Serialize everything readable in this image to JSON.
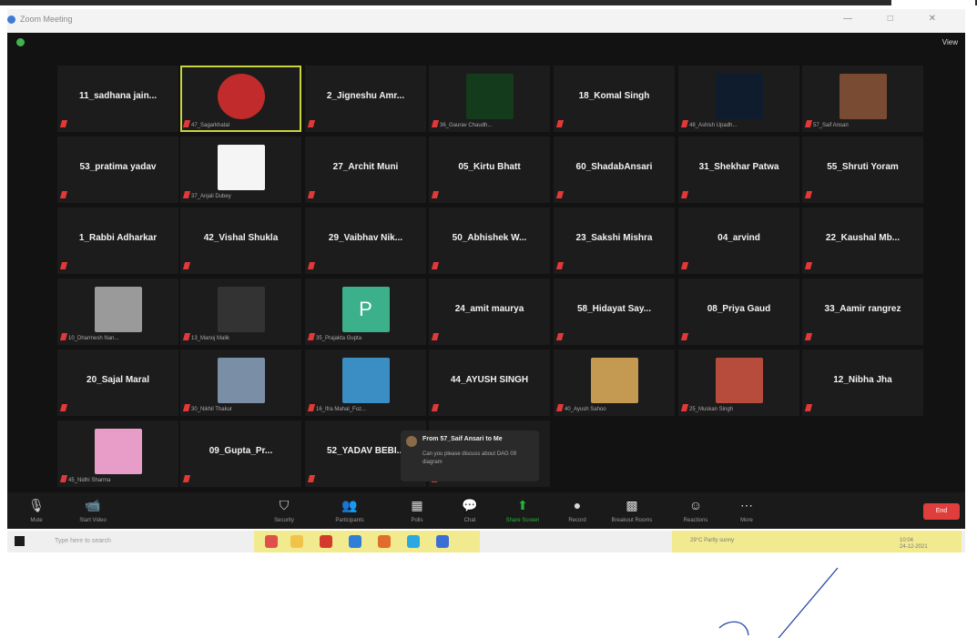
{
  "window": {
    "title": "Zoom Meeting",
    "controls": "— □ ✕"
  },
  "meeting": {
    "view_label": "View"
  },
  "participants": [
    {
      "name": "11_sadhana jain...",
      "label": ""
    },
    {
      "name": "",
      "label": "47_Sagarkhatal",
      "thumb": "logo",
      "active": true
    },
    {
      "name": "2_Jigneshu Amr...",
      "label": ""
    },
    {
      "name": "",
      "label": "36_Gaurav Chaudh...",
      "thumb": "green-g"
    },
    {
      "name": "18_Komal Singh",
      "label": ""
    },
    {
      "name": "",
      "label": "48_Ashish Upadh...",
      "thumb": "blue-bird"
    },
    {
      "name": "",
      "label": "57_Saif Ansari",
      "thumb": "motorbike"
    },
    {
      "name": "53_pratima yadav",
      "label": ""
    },
    {
      "name": "",
      "label": "37_Anjali Dubey",
      "thumb": "white"
    },
    {
      "name": "27_Archit Muni",
      "label": ""
    },
    {
      "name": "05_Kirtu Bhatt",
      "label": ""
    },
    {
      "name": "60_ShadabAnsari",
      "label": ""
    },
    {
      "name": "31_Shekhar Patwa",
      "label": ""
    },
    {
      "name": "55_Shruti Yoram",
      "label": ""
    },
    {
      "name": "1_Rabbi Adharkar",
      "label": ""
    },
    {
      "name": "42_Vishal Shukla",
      "label": ""
    },
    {
      "name": "29_Vaibhav Nik...",
      "label": ""
    },
    {
      "name": "50_Abhishek W...",
      "label": ""
    },
    {
      "name": "23_Sakshi Mishra",
      "label": ""
    },
    {
      "name": "04_arvind",
      "label": ""
    },
    {
      "name": "22_Kaushal Mb...",
      "label": ""
    },
    {
      "name": "",
      "label": "10_Dharmesh Nan...",
      "thumb": "person-bw"
    },
    {
      "name": "",
      "label": "13_Manoj Malik",
      "thumb": "dark"
    },
    {
      "name": "",
      "label": "35_Prajakta Gupta",
      "thumb": "p-green"
    },
    {
      "name": "24_amit maurya",
      "label": ""
    },
    {
      "name": "58_Hidayat Say...",
      "label": ""
    },
    {
      "name": "08_Priya Gaud",
      "label": ""
    },
    {
      "name": "33_Aamir rangrez",
      "label": ""
    },
    {
      "name": "20_Sajal Maral",
      "label": ""
    },
    {
      "name": "",
      "label": "30_Nikhil Thakur",
      "thumb": "person-color"
    },
    {
      "name": "",
      "label": "16_Ifra Mahal_Foz...",
      "thumb": "person-smile"
    },
    {
      "name": "44_AYUSH SINGH",
      "label": ""
    },
    {
      "name": "",
      "label": "40_Ayush Sahoo",
      "thumb": "warm"
    },
    {
      "name": "",
      "label": "25_Muskan Singh",
      "thumb": "person-red"
    },
    {
      "name": "12_Nibha Jha",
      "label": ""
    },
    {
      "name": "",
      "label": "45_Nidhi Sharma",
      "thumb": "person-cartoon"
    },
    {
      "name": "09_Gupta_Pr...",
      "label": ""
    },
    {
      "name": "52_YADAV BEBI...",
      "label": ""
    },
    {
      "name": "45_Ayushi Singh",
      "label": ""
    }
  ],
  "chat_popup": {
    "from": "From 57_Saif Ansari to Me",
    "message": "Can you please discuss about DAG 09 diagram"
  },
  "toolbar": {
    "mute": "Mute",
    "video": "Start Video",
    "security": "Security",
    "participants": "Participants",
    "participants_count": "47",
    "polls": "Polls",
    "chat": "Chat",
    "share": "Share Screen",
    "record": "Record",
    "breakout": "Breakout Rooms",
    "reactions": "Reactions",
    "more": "More",
    "end": "End"
  },
  "taskbar": {
    "search": "Type here to search",
    "weather": "29°C Partly sunny",
    "time": "10:04",
    "date": "24-12-2021"
  },
  "colors": {
    "active_border": "#c8d43a",
    "muted_mic": "#e23838",
    "share_green": "#27b33b",
    "end_red": "#e03d3d",
    "taskbar_highlight": "#f2ea8f"
  }
}
